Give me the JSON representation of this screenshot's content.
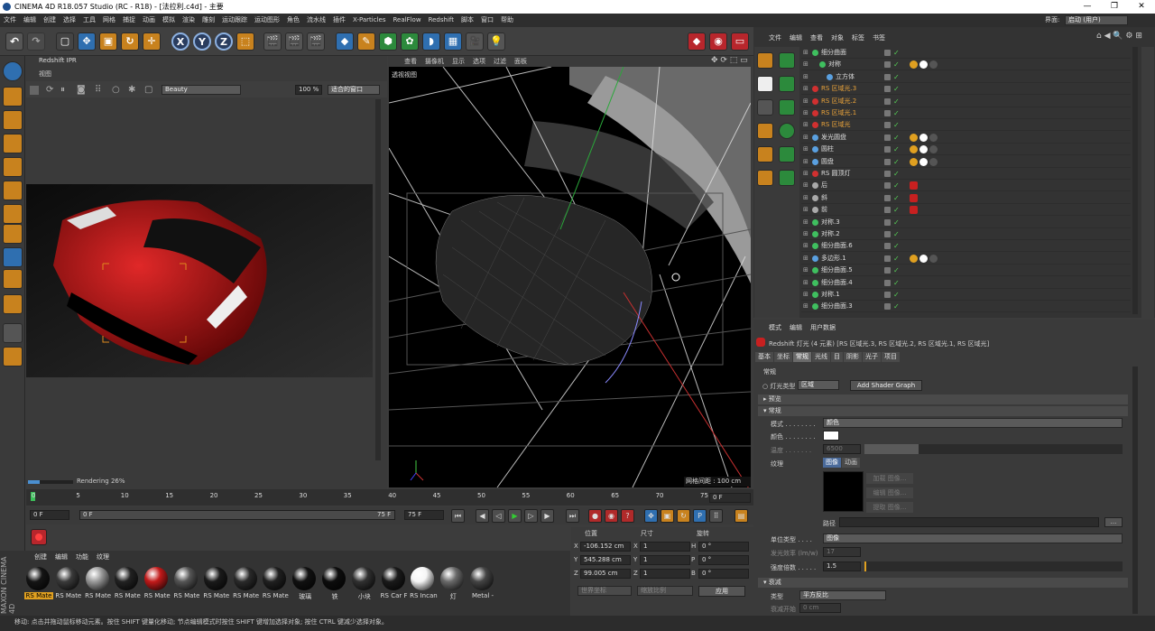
{
  "window": {
    "title": "CINEMA 4D R18.057 Studio (RC - R18) - [法拉利.c4d] - 主要",
    "min": "—",
    "max": "❐",
    "close": "✕"
  },
  "menu": [
    "文件",
    "编辑",
    "创建",
    "选择",
    "工具",
    "网格",
    "捕捉",
    "动画",
    "模拟",
    "渲染",
    "雕刻",
    "运动跟踪",
    "运动图形",
    "角色",
    "流水线",
    "插件",
    "X-Particles",
    "RealFlow",
    "Redshift",
    "脚本",
    "窗口",
    "帮助"
  ],
  "layout": {
    "label": "界面:",
    "value": "启动 (用户)"
  },
  "toolbar": {
    "x": "X",
    "y": "Y",
    "z": "Z"
  },
  "ipr": {
    "title": "Redshift IPR",
    "menu": "视图",
    "aov": "Beauty",
    "zoom": "100 %",
    "fit": "适合的窗口",
    "status": "Rendering 26%",
    "progress": 26
  },
  "viewport": {
    "menus": [
      "查看",
      "摄像机",
      "显示",
      "选项",
      "过滤",
      "面板"
    ],
    "label": "透视视图",
    "grid": "网格间距 : 100 cm"
  },
  "timeline": {
    "ticks": [
      "0",
      "5",
      "10",
      "15",
      "20",
      "25",
      "30",
      "35",
      "40",
      "45",
      "50",
      "55",
      "60",
      "65",
      "70",
      "75"
    ],
    "end_field": "0 F"
  },
  "playback": {
    "start": "0 F",
    "cur": "0 F",
    "end1": "75 F",
    "end2": "75 F"
  },
  "materials": {
    "menu": [
      "创建",
      "编辑",
      "功能",
      "纹理"
    ],
    "items": [
      {
        "label": "RS Mate",
        "color": "#151515",
        "sel": true
      },
      {
        "label": "RS Mate",
        "color": "#3a3a3a"
      },
      {
        "label": "RS Mate",
        "color": "#9a9a9a"
      },
      {
        "label": "RS Mate",
        "color": "#222"
      },
      {
        "label": "RS Mate",
        "color": "#c21a1a"
      },
      {
        "label": "RS Mate",
        "color": "#555"
      },
      {
        "label": "RS Mate",
        "color": "#1a1a1a"
      },
      {
        "label": "RS Mate",
        "color": "#2a2a2a"
      },
      {
        "label": "RS Mate",
        "color": "#202020"
      },
      {
        "label": "玻璃",
        "color": "#111"
      },
      {
        "label": "铁",
        "color": "#0d0d0d"
      },
      {
        "label": "小块",
        "color": "#303030"
      },
      {
        "label": "RS Car F",
        "color": "#1a1a1a"
      },
      {
        "label": "RS Incan",
        "color": "#f5f5f5"
      },
      {
        "label": "灯",
        "color": "#6a6a6a"
      },
      {
        "label": "Metal -",
        "color": "#444"
      }
    ]
  },
  "coords": {
    "h1": "位置",
    "h2": "尺寸",
    "h3": "旋转",
    "rows": [
      {
        "a": "X",
        "pos": "-106.152 cm",
        "b": "X",
        "size": "1",
        "c": "H",
        "rot": "0 °"
      },
      {
        "a": "Y",
        "pos": "545.288 cm",
        "b": "Y",
        "size": "1",
        "c": "P",
        "rot": "0 °"
      },
      {
        "a": "Z",
        "pos": "99.005 cm",
        "b": "Z",
        "size": "1",
        "c": "B",
        "rot": "0 °"
      }
    ],
    "mode1": "世界坐标",
    "mode2": "缩放比例",
    "apply": "应用"
  },
  "status": "移动: 点击并拖动鼠标移动元素。按住 SHIFT 键量化移动; 节点编辑模式时按住 SHIFT 键增加选择对象; 按住 CTRL 键减少选择对象。",
  "objmgr": {
    "menu": [
      "文件",
      "编辑",
      "查看",
      "对象",
      "标签",
      "书签"
    ],
    "rows": [
      {
        "n": "细分曲面",
        "ind": 0,
        "c": "#3fbf5f"
      },
      {
        "n": "对称",
        "ind": 1,
        "c": "#3fbf5f"
      },
      {
        "n": "立方体",
        "ind": 2,
        "c": "#5aa0e0"
      },
      {
        "n": "RS 区域光.3",
        "ind": 0,
        "c": "#d03030",
        "hl": true
      },
      {
        "n": "RS 区域光.2",
        "ind": 0,
        "c": "#d03030",
        "hl": true
      },
      {
        "n": "RS 区域光.1",
        "ind": 0,
        "c": "#d03030",
        "hl": true
      },
      {
        "n": "RS 区域光",
        "ind": 0,
        "c": "#d03030",
        "hl": true
      },
      {
        "n": "发光圆盘",
        "ind": 0,
        "c": "#5aa0e0"
      },
      {
        "n": "圆柱",
        "ind": 0,
        "c": "#5aa0e0"
      },
      {
        "n": "圆盘",
        "ind": 0,
        "c": "#5aa0e0"
      },
      {
        "n": "RS 圆顶灯",
        "ind": 0,
        "c": "#d03030"
      },
      {
        "n": "后",
        "ind": 0,
        "c": "#aaa"
      },
      {
        "n": "斜",
        "ind": 0,
        "c": "#aaa"
      },
      {
        "n": "前",
        "ind": 0,
        "c": "#aaa"
      },
      {
        "n": "对称.3",
        "ind": 0,
        "c": "#3fbf5f"
      },
      {
        "n": "对称.2",
        "ind": 0,
        "c": "#3fbf5f"
      },
      {
        "n": "细分曲面.6",
        "ind": 0,
        "c": "#3fbf5f"
      },
      {
        "n": "多边形.1",
        "ind": 0,
        "c": "#5aa0e0"
      },
      {
        "n": "细分曲面.5",
        "ind": 0,
        "c": "#3fbf5f"
      },
      {
        "n": "细分曲面.4",
        "ind": 0,
        "c": "#3fbf5f"
      },
      {
        "n": "对称.1",
        "ind": 0,
        "c": "#3fbf5f"
      },
      {
        "n": "细分曲面.3",
        "ind": 0,
        "c": "#3fbf5f"
      }
    ]
  },
  "attr": {
    "menu": [
      "模式",
      "编辑",
      "用户数据"
    ],
    "title": "Redshift 灯光 (4 元素) [RS 区域光.3, RS 区域光.2, RS 区域光.1, RS 区域光]",
    "tabs": [
      "基本",
      "坐标",
      "常规",
      "光线",
      "目",
      "阴影",
      "光子",
      "项目"
    ],
    "sec_general": "常规",
    "light_type_label": "灯光类型",
    "light_type": "区域",
    "shader_btn": "Add Shader Graph",
    "sec_preview": "▸ 预览",
    "sec_normal": "▾ 常规",
    "mode_label": "模式 . . . . . . . .",
    "mode": "颜色",
    "color_label": "颜色 . . . . . . . .",
    "temp_label": "温度 . . . . . . .",
    "temp": "6500",
    "tex_label": "纹理",
    "tex_tab1": "图像",
    "tex_tab2": "动画",
    "load": "加载 图像...",
    "edit": "编辑 图像...",
    "extract": "提取 图像...",
    "path_label": "路径",
    "path_btn": "...",
    "unit_label": "单位类型 . . . .",
    "unit": "图像",
    "eff_label": "发光效率 (lm/w)",
    "eff": "17",
    "int_label": "强度倍数 . . . . .",
    "intensity": "1.5",
    "sec_decay": "▾ 衰减",
    "type_label": "类型",
    "decay": "平方反比",
    "ds_label": "衰减开始",
    "ds": "0 cm",
    "de_label": "衰减结束"
  }
}
